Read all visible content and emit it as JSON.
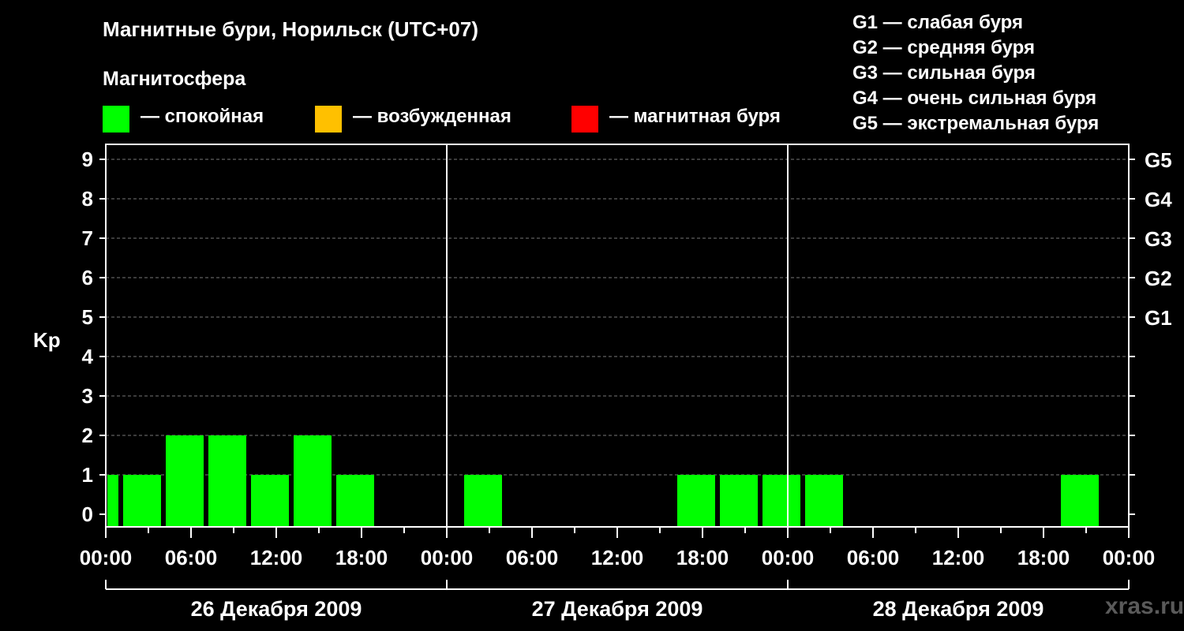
{
  "chart_data": {
    "type": "bar",
    "title": "Магнитные бури, Норильск (UTC+07)",
    "ylabel": "Kp",
    "ylim": [
      0,
      9
    ],
    "yticks": [
      "0",
      "1",
      "2",
      "3",
      "4",
      "5",
      "6",
      "7",
      "8",
      "9"
    ],
    "right_axis_labels": [
      {
        "kp": 5,
        "label": "G1"
      },
      {
        "kp": 6,
        "label": "G2"
      },
      {
        "kp": 7,
        "label": "G3"
      },
      {
        "kp": 8,
        "label": "G4"
      },
      {
        "kp": 9,
        "label": "G5"
      }
    ],
    "x_tick_labels": [
      "00:00",
      "06:00",
      "12:00",
      "18:00",
      "00:00",
      "06:00",
      "12:00",
      "18:00",
      "00:00",
      "06:00",
      "12:00",
      "18:00",
      "00:00"
    ],
    "days": [
      "26 Декабря 2009",
      "27 Декабря 2009",
      "28 Декабря 2009"
    ],
    "grid": true,
    "bar_interval_hours": 3,
    "series": [
      {
        "kp_3h_intervals": [
          1,
          2,
          2,
          1,
          2,
          1,
          0,
          0,
          1,
          0,
          0,
          0,
          0,
          1,
          1,
          1,
          1,
          0,
          0,
          0,
          0,
          0,
          1,
          0
        ]
      }
    ],
    "first_bar_kp": 1,
    "colors": {
      "quiet": "#00ff00",
      "disturbed": "#ffc000",
      "storm": "#ff0000",
      "background": "#000000",
      "grid": "#777777"
    }
  },
  "magnetosphere": {
    "heading": "Магнитосфера",
    "legend": [
      {
        "label": "— спокойная",
        "color": "#00ff00"
      },
      {
        "label": "— возбужденная",
        "color": "#ffc000"
      },
      {
        "label": "— магнитная буря",
        "color": "#ff0000"
      }
    ]
  },
  "storm_scale": [
    "G1 — слабая буря",
    "G2 — средняя буря",
    "G3 — сильная буря",
    "G4 — очень сильная буря",
    "G5 — экстремальная буря"
  ],
  "watermark": "xras.ru"
}
